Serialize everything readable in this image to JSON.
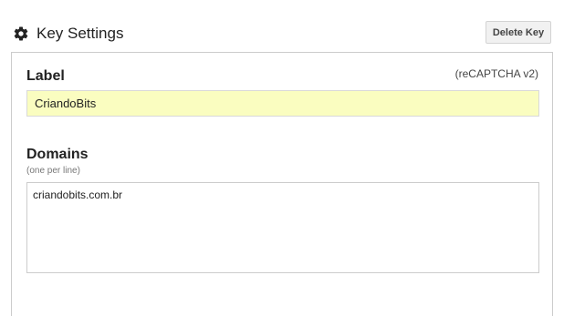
{
  "header": {
    "title": "Key Settings",
    "icon": "gear-icon",
    "delete_button_label": "Delete Key"
  },
  "label_section": {
    "heading": "Label",
    "version": "(reCAPTCHA v2)",
    "value": "CriandoBits",
    "field_color": "#fafdc0"
  },
  "domains_section": {
    "heading": "Domains",
    "hint": "(one per line)",
    "value": "criandobits.com.br"
  }
}
